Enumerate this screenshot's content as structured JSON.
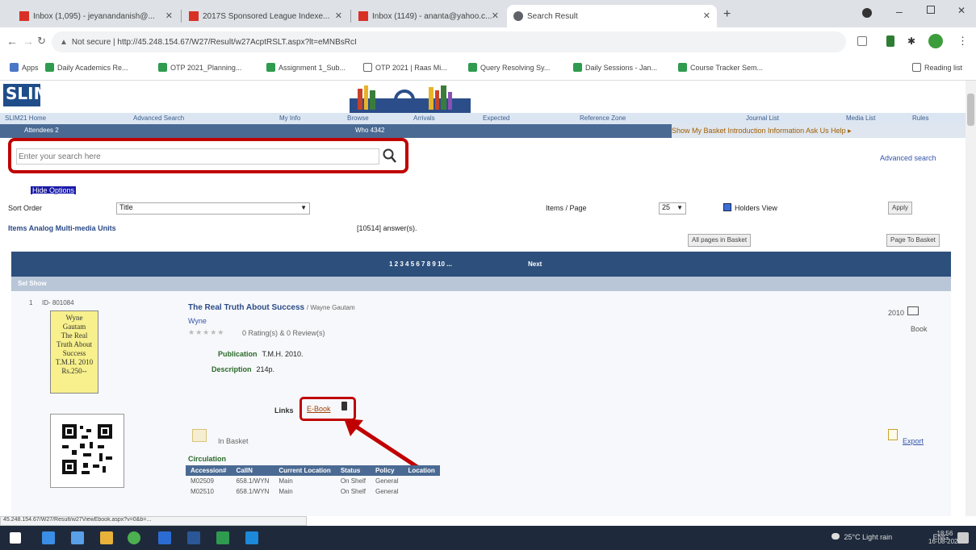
{
  "browser": {
    "tabs": [
      {
        "label": "Inbox (1,095) - jeyanandanish@..."
      },
      {
        "label": "2017S Sponsored League Indexe..."
      },
      {
        "label": "Inbox (1149) - ananta@yahoo.c..."
      },
      {
        "label": "Search Result"
      }
    ],
    "url": "Not secure | http://45.248.154.67/W27/Result/w27AcptRSLT.aspx?lt=eMNBsRcI"
  },
  "bookmarks": [
    "Apps",
    "Daily Academics Re...",
    "OTP 2021_Planning...",
    "Assignment 1_Sub...",
    "OTP 2021 | Raas Mi...",
    "Query Resolving Sy...",
    "Daily Sessions - Jan...",
    "Course Tracker Sem..."
  ],
  "bookmarks_right": "Reading list",
  "site": {
    "logo": "SLIM",
    "nav": [
      "SLIM21 Home",
      "Advanced Search",
      "My Info",
      "Browse",
      "Arrivals",
      "Expected",
      "Reference Zone",
      "Journal List",
      "Media List",
      "Rules"
    ],
    "welcome": "Attendees 2",
    "visitor_id": "Who 4342",
    "top_links": "Show My Basket  Introduction  Information  Ask Us  Help ▸",
    "search_placeholder": "Enter your search here",
    "advanced_search": "Advanced search",
    "hide_options": "Hide Options",
    "sort_label": "Sort Order",
    "sort_value": "Title",
    "items_label": "Items / Page",
    "items_value": "25",
    "holders_label": "Holders View",
    "apply": "Apply",
    "search_context": "Items Analog Multi-media Units",
    "count": "[10514] answer(s).",
    "all_pages_btn": "All pages in Basket",
    "page_basket_btn": "Page To Basket",
    "pagination": "1 2 3 4 5 6 7 8 9 10 ...",
    "next": "Next",
    "select": "Sel Show"
  },
  "record": {
    "index": "1",
    "id": "ID- 801084",
    "cover_text": [
      "Wyne",
      "Gautam",
      "The Real",
      "Truth About",
      "Success",
      "T.M.H. 2010",
      "Rs.250--"
    ],
    "title": "The Real Truth About Success",
    "author": "/ Wayne Gautam",
    "author_link": "Wyne",
    "rating": "0 Rating(s) & 0 Review(s)",
    "publication_label": "Publication",
    "publication": "T.M.H. 2010.",
    "description_label": "Description",
    "description": "214p.",
    "links_label": "Links",
    "ebook": "E-Book",
    "year": "2010",
    "type": "Book",
    "basket": "In Basket",
    "export": "Export",
    "circulation_label": "Circulation",
    "circ_headers": [
      "Accession#",
      "CallN",
      "Current Location",
      "Status",
      "Policy",
      "Location"
    ],
    "circ_rows": [
      [
        "M02509",
        "658.1/WYN",
        "Main",
        "On Shelf",
        "General",
        ""
      ],
      [
        "M02510",
        "658.1/WYN",
        "Main",
        "On Shelf",
        "General",
        ""
      ]
    ]
  },
  "status_url": "45.248.154.67/W27/Result/w27ViewEbook.aspx?v=0&b=...",
  "tray": {
    "weather": "25°C  Light rain",
    "lang": "ENG"
  },
  "clock": {
    "time": "18:56",
    "date": "16-08-2021"
  },
  "colors": {
    "accent_red": "#c00000",
    "nav_blue": "#2c4f7c"
  }
}
